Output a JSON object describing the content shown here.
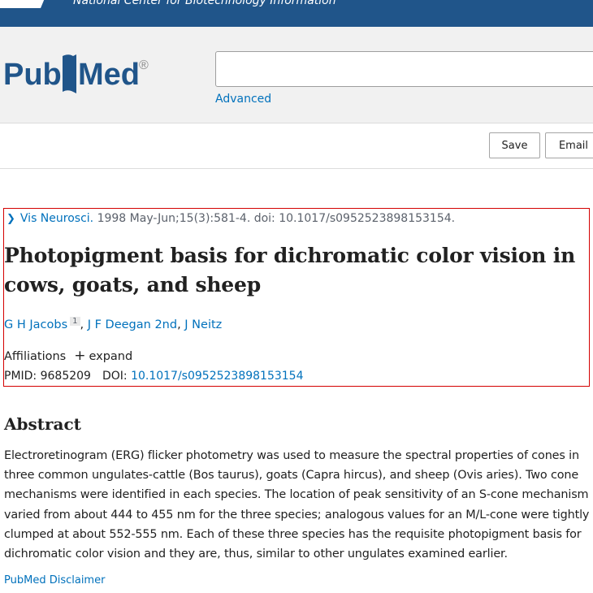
{
  "header": {
    "org_name": "National Center for Biotechnology Information",
    "brand_color": "#20558a"
  },
  "search": {
    "logo_text_left": "Pub",
    "logo_text_right": "Med",
    "logo_registered": "®",
    "query": "",
    "advanced_label": "Advanced"
  },
  "actions": {
    "save_label": "Save",
    "email_label": "Email"
  },
  "article": {
    "journal": "Vis Neurosci.",
    "citation": " 1998 May-Jun;15(3):581-4. doi: 10.1017/s0952523898153154.",
    "title": "Photopigment basis for dichromatic color vision in cows, goats, and sheep",
    "authors": [
      {
        "name": "G H Jacobs",
        "affiliation_ref": "1"
      },
      {
        "name": "J F Deegan 2nd"
      },
      {
        "name": "J Neitz"
      }
    ],
    "affiliations_label": "Affiliations",
    "expand_label": "expand",
    "pmid_label": "PMID: 9685209",
    "doi_label": "DOI:",
    "doi_value": "10.1017/s0952523898153154"
  },
  "abstract": {
    "heading": "Abstract",
    "text": "Electroretinogram (ERG) flicker photometry was used to measure the spectral properties of cones in three common ungulates-cattle (Bos taurus), goats (Capra hircus), and sheep (Ovis aries). Two cone mechanisms were identified in each species. The location of peak sensitivity of an S-cone mechanism varied from about 444 to 455 nm for the three species; analogous values for an M/L-cone were tightly clumped at about 552-555 nm. Each of these three species has the requisite photopigment basis for dichromatic color vision and they are, thus, similar to other ungulates examined earlier."
  },
  "footer": {
    "disclaimer_label": "PubMed Disclaimer"
  },
  "colors": {
    "link": "#0071bc",
    "highlight_border": "#d40000"
  }
}
